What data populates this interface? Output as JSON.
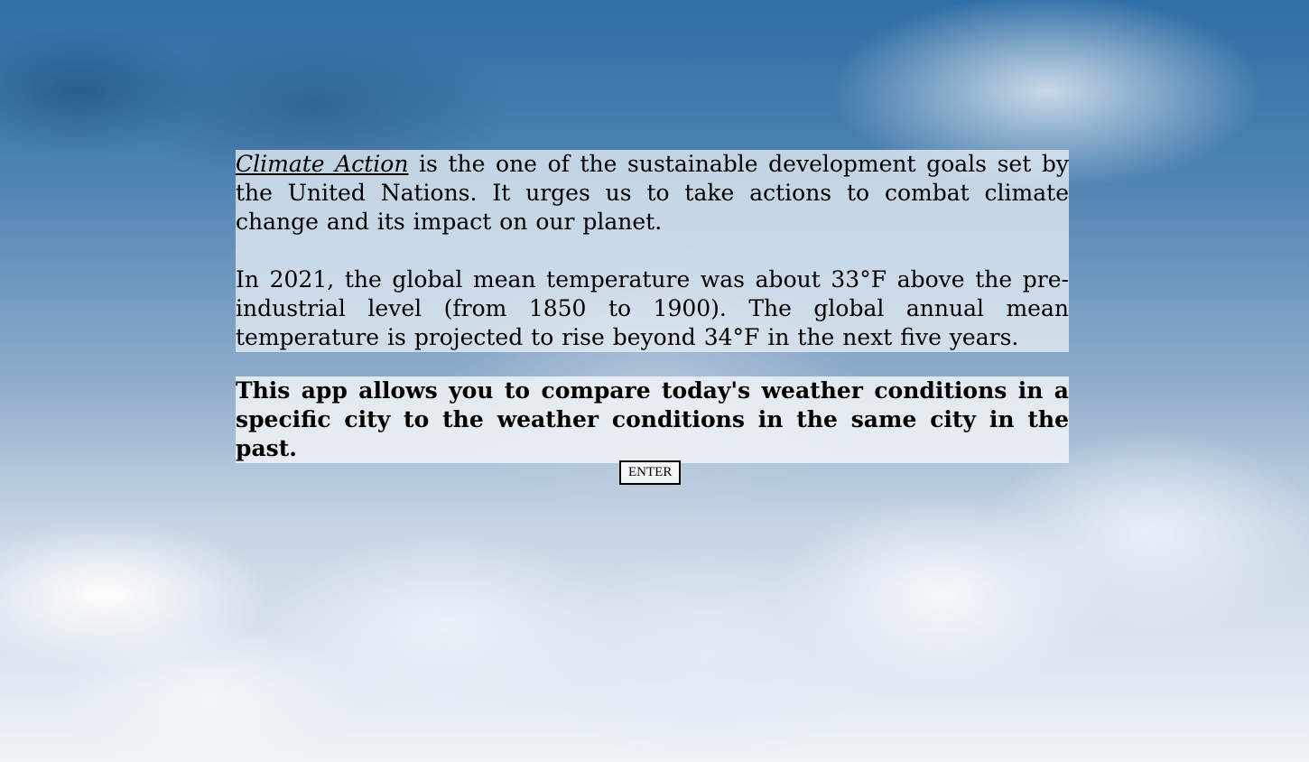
{
  "content": {
    "link_text": "Climate Action",
    "paragraph1_rest": " is the one of the sustainable development goals set by the United Nations. It urges us to take actions to combat climate change and its impact on our planet.",
    "paragraph2": "In 2021, the global mean temperature was about 33°F above the pre-industrial level (from 1850 to 1900). The global annual mean temperature is projected to rise beyond 34°F in the next five years.",
    "highlight": "This app allows you to compare today's weather conditions in a specific city to the weather conditions in the same city in the past."
  },
  "actions": {
    "enter_label": "ENTER"
  }
}
